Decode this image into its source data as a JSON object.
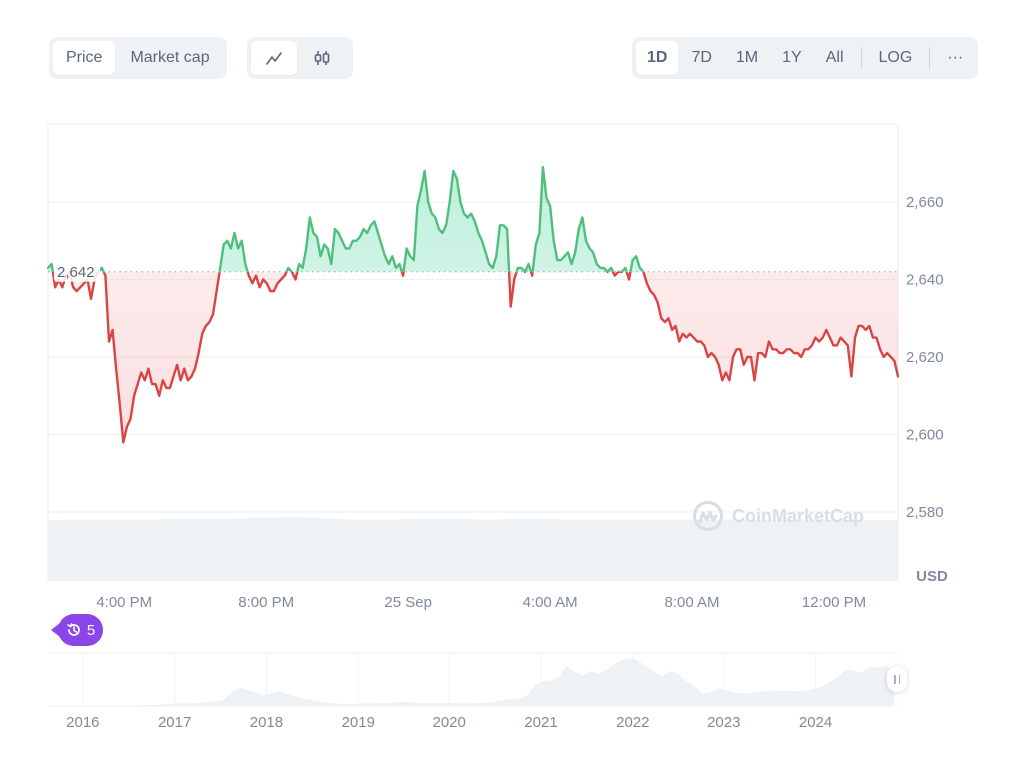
{
  "toolbar": {
    "type_tabs": [
      {
        "label": "Price",
        "active": true
      },
      {
        "label": "Market cap",
        "active": false
      }
    ],
    "style_tabs": [
      {
        "icon": "line-chart-icon",
        "active": true
      },
      {
        "icon": "candlestick-icon",
        "active": false
      }
    ],
    "range_tabs": [
      {
        "label": "1D",
        "active": true
      },
      {
        "label": "7D",
        "active": false
      },
      {
        "label": "1M",
        "active": false
      },
      {
        "label": "1Y",
        "active": false
      },
      {
        "label": "All",
        "active": false
      }
    ],
    "log_label": "LOG",
    "more_label": "···"
  },
  "colors": {
    "up": "#16c784",
    "up_line": "#4fbf7d",
    "down_line": "#d94545",
    "grid": "#eff2f5",
    "volume": "#eff2f5",
    "events_badge": "#8b45e8"
  },
  "events_badge": {
    "icon": "history-icon",
    "count": "5"
  },
  "watermark": {
    "text": "CoinMarketCap",
    "icon": "coinmarketcap-logo-icon"
  },
  "chart_data": {
    "type": "line",
    "title": "",
    "xlabel": "",
    "ylabel": "USD",
    "currency_label": "USD",
    "baseline": 2642,
    "baseline_label": "2,642",
    "ylim": [
      2577,
      2679
    ],
    "y_ticks": [
      2580,
      2600,
      2620,
      2640,
      2660
    ],
    "y_tick_labels": [
      "2,580",
      "2,600",
      "2,620",
      "2,640",
      "2,660"
    ],
    "x_ticks": [
      {
        "label": "4:00 PM",
        "pos": 0.045
      },
      {
        "label": "8:00 PM",
        "pos": 0.212
      },
      {
        "label": "25 Sep",
        "pos": 0.379
      },
      {
        "label": "4:00 AM",
        "pos": 0.546
      },
      {
        "label": "8:00 AM",
        "pos": 0.713
      },
      {
        "label": "12:00 PM",
        "pos": 0.88
      }
    ],
    "grid": true,
    "series": [
      {
        "name": "Price",
        "values": [
          2643,
          2644,
          2638,
          2640,
          2638,
          2641,
          2642,
          2638,
          2637,
          2638,
          2639,
          2640,
          2635,
          2640,
          2642,
          2643,
          2641,
          2624,
          2627,
          2617,
          2608,
          2598,
          2602,
          2604,
          2610,
          2613,
          2616,
          2614,
          2617,
          2613,
          2613,
          2610,
          2614,
          2612,
          2612,
          2615,
          2618,
          2614,
          2617,
          2614,
          2615,
          2617,
          2621,
          2626,
          2628,
          2629,
          2631,
          2637,
          2643,
          2649,
          2650,
          2648,
          2652,
          2648,
          2650,
          2644,
          2641,
          2639,
          2641,
          2638,
          2640,
          2639,
          2637,
          2637,
          2639,
          2640,
          2641,
          2643,
          2642,
          2640,
          2644,
          2643,
          2648,
          2656,
          2652,
          2651,
          2646,
          2649,
          2648,
          2644,
          2653,
          2652,
          2650,
          2648,
          2648,
          2650,
          2650,
          2651,
          2653,
          2652,
          2654,
          2655,
          2652,
          2649,
          2646,
          2644,
          2646,
          2643,
          2644,
          2641,
          2648,
          2646,
          2645,
          2659,
          2663,
          2668,
          2660,
          2657,
          2656,
          2653,
          2652,
          2654,
          2660,
          2668,
          2666,
          2660,
          2657,
          2656,
          2657,
          2655,
          2652,
          2650,
          2647,
          2644,
          2643,
          2646,
          2654,
          2654,
          2653,
          2633,
          2640,
          2643,
          2643,
          2642,
          2644,
          2641,
          2649,
          2652,
          2669,
          2661,
          2659,
          2650,
          2645,
          2645,
          2646,
          2647,
          2644,
          2647,
          2653,
          2656,
          2650,
          2648,
          2647,
          2644,
          2643,
          2643,
          2642,
          2643,
          2641,
          2642,
          2642,
          2643,
          2640,
          2645,
          2646,
          2643,
          2642,
          2639,
          2637,
          2636,
          2634,
          2630,
          2629,
          2630,
          2627,
          2628,
          2624,
          2626,
          2625,
          2626,
          2625,
          2624,
          2624,
          2623,
          2620,
          2621,
          2620,
          2618,
          2614,
          2616,
          2614,
          2620,
          2622,
          2622,
          2618,
          2620,
          2620,
          2614,
          2621,
          2621,
          2620,
          2624,
          2622,
          2622,
          2621,
          2621,
          2622,
          2622,
          2621,
          2621,
          2620,
          2622,
          2622,
          2623,
          2625,
          2624,
          2625,
          2627,
          2625,
          2623,
          2623,
          2625,
          2624,
          2623,
          2615,
          2625,
          2628,
          2628,
          2627,
          2628,
          2625,
          2625,
          2622,
          2620,
          2621,
          2620,
          2619,
          2615
        ],
        "color_above_baseline": "#4fbf7d",
        "color_below_baseline": "#d94545"
      },
      {
        "name": "Volume",
        "type": "bar",
        "values_relative": [
          0.92,
          0.93,
          0.93,
          0.93,
          0.93,
          0.93,
          0.93,
          0.93,
          0.94,
          0.94,
          0.94,
          0.94,
          0.94,
          0.95,
          0.96,
          0.96,
          0.97,
          0.97,
          0.96,
          0.95,
          0.94,
          0.93,
          0.93,
          0.93,
          0.93,
          0.94,
          0.94,
          0.94,
          0.94,
          0.94,
          0.93,
          0.93,
          0.94,
          0.94,
          0.94,
          0.94,
          0.93,
          0.93,
          0.93,
          0.93,
          0.93,
          0.93,
          0.93,
          0.93,
          0.93,
          0.93,
          0.93,
          0.93,
          0.93,
          0.93,
          0.93,
          0.93,
          0.93,
          0.93,
          0.93,
          0.93,
          0.93,
          0.92,
          0.92,
          0.92
        ]
      }
    ]
  },
  "overview": {
    "year_labels": [
      "2016",
      "2017",
      "2018",
      "2019",
      "2020",
      "2021",
      "2022",
      "2023",
      "2024"
    ],
    "year_positions": [
      0.041,
      0.149,
      0.257,
      0.365,
      0.472,
      0.58,
      0.688,
      0.795,
      0.903
    ],
    "history_values": [
      0,
      0,
      0,
      0,
      0,
      0,
      0,
      0,
      0,
      0,
      0.01,
      0.01,
      0.02,
      0.02,
      0.03,
      0.04,
      0.06,
      0.05,
      0.05,
      0.07,
      0.09,
      0.09,
      0.12,
      0.28,
      0.38,
      0.32,
      0.28,
      0.22,
      0.26,
      0.3,
      0.24,
      0.2,
      0.15,
      0.12,
      0.09,
      0.07,
      0.05,
      0.04,
      0.04,
      0.05,
      0.05,
      0.06,
      0.06,
      0.07,
      0.08,
      0.09,
      0.07,
      0.06,
      0.06,
      0.06,
      0.07,
      0.06,
      0.05,
      0.06,
      0.06,
      0.07,
      0.09,
      0.12,
      0.14,
      0.16,
      0.22,
      0.42,
      0.5,
      0.52,
      0.6,
      0.82,
      0.7,
      0.62,
      0.72,
      0.66,
      0.75,
      0.85,
      0.95,
      0.98,
      0.92,
      0.8,
      0.68,
      0.6,
      0.72,
      0.65,
      0.5,
      0.4,
      0.25,
      0.28,
      0.36,
      0.32,
      0.28,
      0.26,
      0.26,
      0.29,
      0.3,
      0.32,
      0.3,
      0.31,
      0.3,
      0.32,
      0.35,
      0.4,
      0.5,
      0.6,
      0.75,
      0.72,
      0.68,
      0.8,
      0.78,
      0.82,
      0.72
    ],
    "handle": "range-handle"
  }
}
